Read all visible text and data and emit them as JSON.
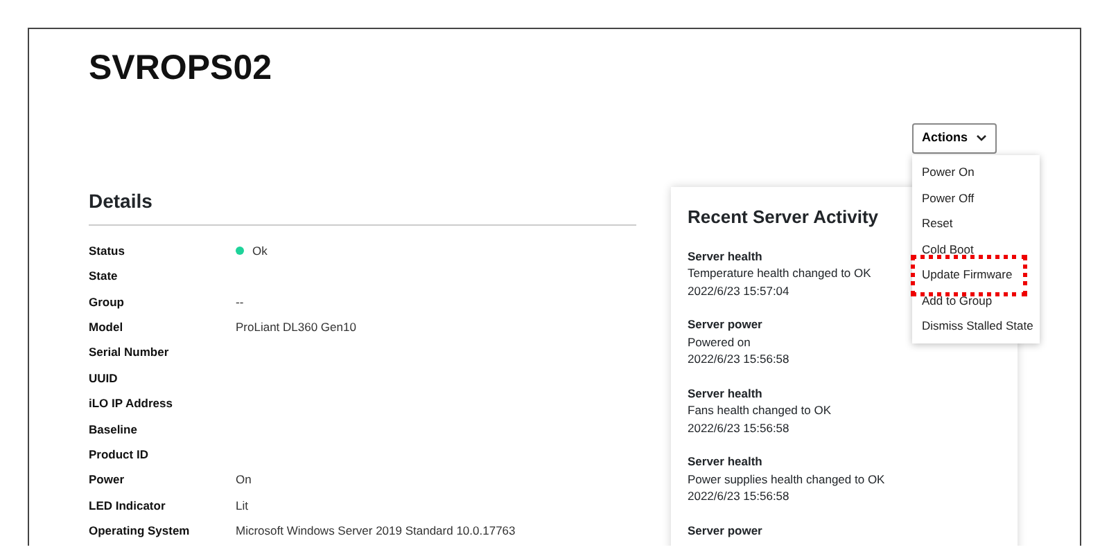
{
  "title": "SVROPS02",
  "actions": {
    "label": "Actions",
    "expanded": true,
    "items": [
      {
        "label": "Power On",
        "highlighted": false
      },
      {
        "label": "Power Off",
        "highlighted": false
      },
      {
        "label": "Reset",
        "highlighted": false
      },
      {
        "label": "Cold Boot",
        "highlighted": false
      },
      {
        "label": "Update Firmware",
        "highlighted": true
      },
      {
        "label": "Add to Group",
        "highlighted": false
      },
      {
        "label": "Dismiss Stalled State",
        "highlighted": false
      }
    ]
  },
  "details": {
    "heading": "Details",
    "rows": [
      {
        "label": "Status",
        "value": "Ok",
        "color": "#1ed39a"
      },
      {
        "label": "State"
      },
      {
        "label": "Group",
        "value": "--"
      },
      {
        "label": "Model",
        "value": "ProLiant DL360 Gen10"
      },
      {
        "label": "Serial Number"
      },
      {
        "label": "UUID"
      },
      {
        "label": "iLO IP Address"
      },
      {
        "label": "Baseline"
      },
      {
        "label": "Product ID"
      },
      {
        "label": "Power",
        "value": "On"
      },
      {
        "label": "LED Indicator",
        "value": "Lit"
      },
      {
        "label": "Operating System",
        "value": "Microsoft Windows Server 2019 Standard 10.0.17763"
      }
    ]
  },
  "activity": {
    "heading": "Recent Server Activity",
    "entries": [
      {
        "title": "Server health",
        "description": "Temperature health changed to OK",
        "time": "2022/6/23 15:57:04"
      },
      {
        "title": "Server power",
        "description": "Powered on",
        "time": "2022/6/23 15:56:58"
      },
      {
        "title": "Server health",
        "description": "Fans health changed to OK",
        "time": "2022/6/23 15:56:58"
      },
      {
        "title": "Server health",
        "description": "Power supplies health changed to OK",
        "time": "2022/6/23 15:56:58"
      },
      {
        "title": "Server power"
      }
    ]
  }
}
